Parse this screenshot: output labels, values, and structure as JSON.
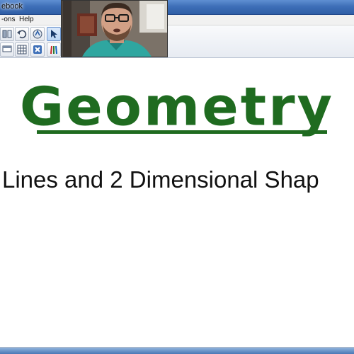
{
  "window": {
    "title": "ebook"
  },
  "menu": {
    "items": [
      "-ons",
      "Help"
    ]
  },
  "toolbar": {
    "buttons": [
      "page-sorter",
      "undo",
      "stamp",
      "select-pointer",
      "screen-shade",
      "table",
      "delete",
      "pens"
    ]
  },
  "slide": {
    "heading": "Geometry",
    "subtitle": "Lines and 2 Dimensional Shap",
    "heading_color": "#1f6b20"
  },
  "colors": {
    "titlebar": "#3e6fb8",
    "menubar": "#f1f1f1",
    "canvas": "#ffffff",
    "heading": "#1f6b20"
  }
}
